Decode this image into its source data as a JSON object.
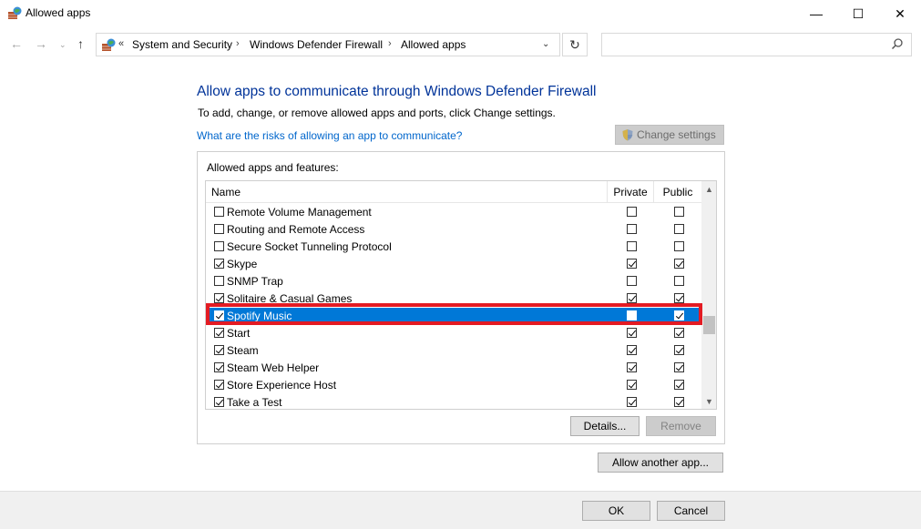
{
  "window": {
    "title": "Allowed apps",
    "minimize": "—",
    "maximize": "☐",
    "close": "✕"
  },
  "nav": {
    "back": "←",
    "forward": "→",
    "history": "⌄",
    "up": "↑",
    "overflow": "«",
    "breadcrumbs": [
      "System and Security",
      "Windows Defender Firewall",
      "Allowed apps"
    ],
    "separator": "›",
    "dropdown": "⌄",
    "refresh": "↻",
    "search_placeholder": ""
  },
  "content": {
    "heading": "Allow apps to communicate through Windows Defender Firewall",
    "subtitle": "To add, change, or remove allowed apps and ports, click Change settings.",
    "risks_link": "What are the risks of allowing an app to communicate?",
    "change_settings": "Change settings",
    "group_label": "Allowed apps and features:",
    "columns": {
      "name": "Name",
      "private": "Private",
      "public": "Public"
    },
    "apps": [
      {
        "name": "Remote Volume Management",
        "enabled": false,
        "private": false,
        "public": false
      },
      {
        "name": "Routing and Remote Access",
        "enabled": false,
        "private": false,
        "public": false
      },
      {
        "name": "Secure Socket Tunneling Protocol",
        "enabled": false,
        "private": false,
        "public": false
      },
      {
        "name": "Skype",
        "enabled": true,
        "private": true,
        "public": true
      },
      {
        "name": "SNMP Trap",
        "enabled": false,
        "private": false,
        "public": false
      },
      {
        "name": "Solitaire & Casual Games",
        "enabled": true,
        "private": true,
        "public": true
      },
      {
        "name": "Spotify Music",
        "enabled": true,
        "private": false,
        "public": true,
        "selected": true
      },
      {
        "name": "Start",
        "enabled": true,
        "private": true,
        "public": true
      },
      {
        "name": "Steam",
        "enabled": true,
        "private": true,
        "public": true
      },
      {
        "name": "Steam Web Helper",
        "enabled": true,
        "private": true,
        "public": true
      },
      {
        "name": "Store Experience Host",
        "enabled": true,
        "private": true,
        "public": true
      },
      {
        "name": "Take a Test",
        "enabled": true,
        "private": true,
        "public": true
      }
    ],
    "scroll_up": "▲",
    "scroll_down": "▼",
    "details_button": "Details...",
    "remove_button": "Remove",
    "allow_another_button": "Allow another app..."
  },
  "footer": {
    "ok": "OK",
    "cancel": "Cancel"
  },
  "colors": {
    "heading": "#003399",
    "link": "#0066cc",
    "selection": "#0078d7",
    "highlight_border": "#e31b23"
  }
}
